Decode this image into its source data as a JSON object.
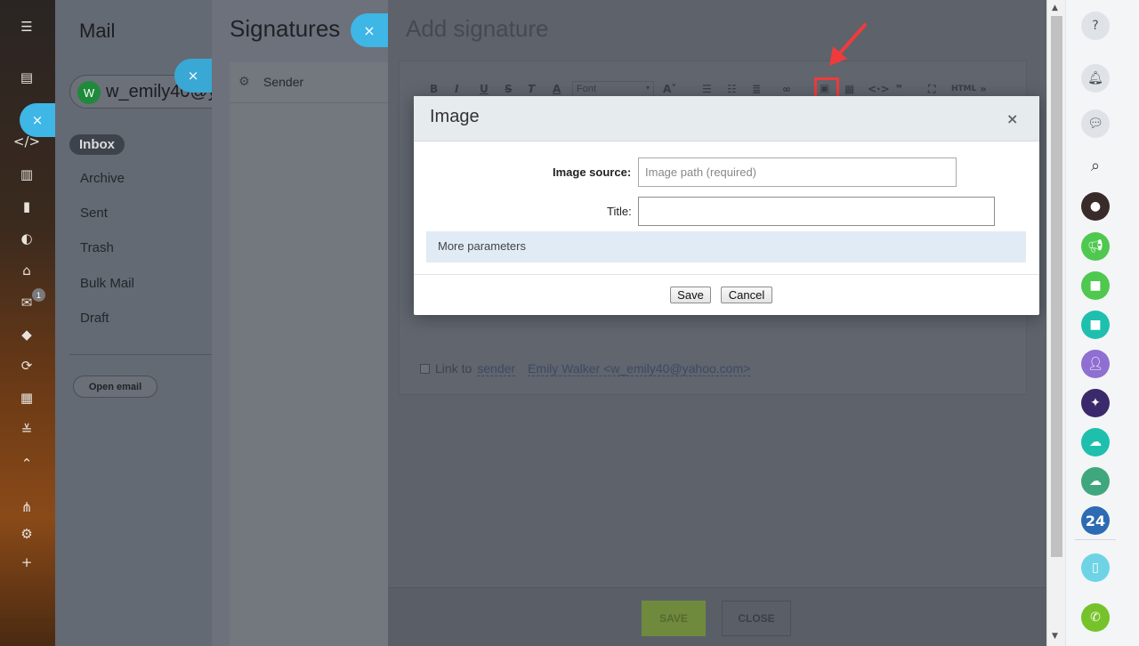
{
  "leftnav": {
    "icons": [
      "menu-icon",
      "inbox-tray-icon",
      "code-icon",
      "book-icon",
      "bar-chart-icon",
      "moon-icon",
      "shop-icon",
      "mail-icon",
      "box-icon",
      "refresh-icon",
      "film-icon",
      "sliders-icon",
      "chevron-up-icon",
      "sitemap-icon",
      "gear-icon",
      "plus-icon"
    ],
    "mail_badge": "1"
  },
  "mail": {
    "title": "Mail",
    "account_initial": "W",
    "account_text": "w_emily40@y",
    "folders": {
      "inbox": "Inbox",
      "archive": "Archive",
      "sent": "Sent",
      "trash": "Trash",
      "bulk": "Bulk Mail",
      "draft": "Draft"
    },
    "open_email": "Open email"
  },
  "signatures": {
    "title": "Signatures",
    "sender_label": "Sender"
  },
  "add_signature": {
    "title": "Add signature",
    "toolbar": {
      "font_label": "Font",
      "html_label": "HTML"
    },
    "link_to_label": "Link to",
    "link_sender": "sender",
    "link_email": "Emily Walker <w_emily40@yahoo.com>",
    "save_label": "SAVE",
    "close_label": "CLOSE"
  },
  "dialog": {
    "title": "Image",
    "close_glyph": "×",
    "image_source_label": "Image source:",
    "image_source_placeholder": "Image path (required)",
    "title_label": "Title:",
    "title_value": "",
    "more_params": "More parameters",
    "save": "Save",
    "cancel": "Cancel"
  },
  "close_glyph": "×",
  "rightrail": {
    "items": [
      {
        "icon": "help-icon",
        "color": "#dfe3e7"
      },
      {
        "icon": "bell-icon",
        "color": "#dfe3e7"
      },
      {
        "icon": "chat-icon",
        "color": "#dfe3e7"
      },
      {
        "icon": "search-icon",
        "color": "transparent"
      },
      {
        "icon": "user-avatar-icon",
        "color": "#3a2b2b"
      },
      {
        "icon": "megaphone-icon",
        "color": "#4fc84f"
      },
      {
        "icon": "video-camera-icon",
        "color": "#4fc84f"
      },
      {
        "icon": "video-call-icon",
        "color": "#1fbfae"
      },
      {
        "icon": "person-icon",
        "color": "#8f6fd1"
      },
      {
        "icon": "group-photo-icon",
        "color": "#3b2a6b"
      },
      {
        "icon": "cloud-icon",
        "color": "#1fbfae"
      },
      {
        "icon": "cloud-sync-icon",
        "color": "#3fa77d"
      },
      {
        "icon": "bitrix24-icon",
        "color": "#2d6bb3"
      },
      {
        "icon": "device-icon",
        "color": "#6fd3e6"
      },
      {
        "icon": "phone-icon",
        "color": "#76c22a"
      }
    ],
    "label_24": "24"
  },
  "colors": {
    "accent_close": "#3eb6e6",
    "highlight_red": "#ef3b3b"
  }
}
